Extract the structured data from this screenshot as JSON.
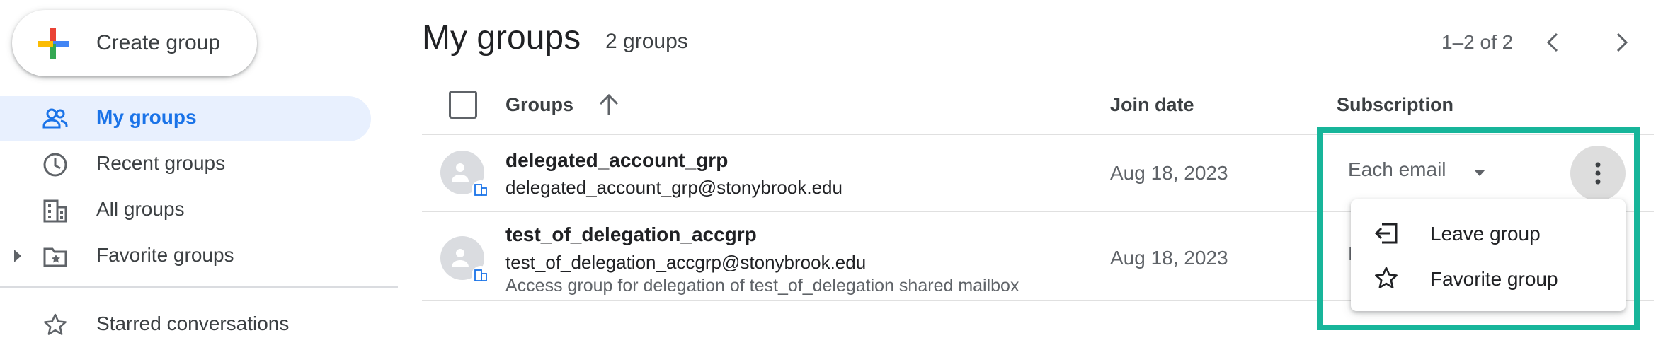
{
  "sidebar": {
    "create_label": "Create group",
    "items": [
      {
        "label": "My groups",
        "icon": "people-icon",
        "active": true
      },
      {
        "label": "Recent groups",
        "icon": "clock-icon"
      },
      {
        "label": "All groups",
        "icon": "building-icon"
      },
      {
        "label": "Favorite groups",
        "icon": "folder-star-icon"
      },
      {
        "label": "Starred conversations",
        "icon": "star-icon"
      }
    ]
  },
  "header": {
    "title": "My groups",
    "count": "2 groups",
    "pagination": "1–2 of 2"
  },
  "table": {
    "columns": [
      "Groups",
      "Join date",
      "Subscription"
    ],
    "rows": [
      {
        "name": "delegated_account_grp",
        "email": "delegated_account_grp@stonybrook.edu",
        "description": "",
        "join_date": "Aug 18, 2023",
        "subscription": "Each email"
      },
      {
        "name": "test_of_delegation_accgrp",
        "email": "test_of_delegation_accgrp@stonybrook.edu",
        "description": "Access group for delegation of test_of_delegation shared mailbox",
        "join_date": "Aug 18, 2023",
        "subscription": "E"
      }
    ]
  },
  "menu": {
    "items": [
      {
        "label": "Leave group",
        "icon": "leave-icon"
      },
      {
        "label": "Favorite group",
        "icon": "star-outline-icon"
      }
    ]
  },
  "colors": {
    "accent": "#1a73e8",
    "active_bg": "#e8f0fe",
    "highlight": "#17b59a"
  }
}
